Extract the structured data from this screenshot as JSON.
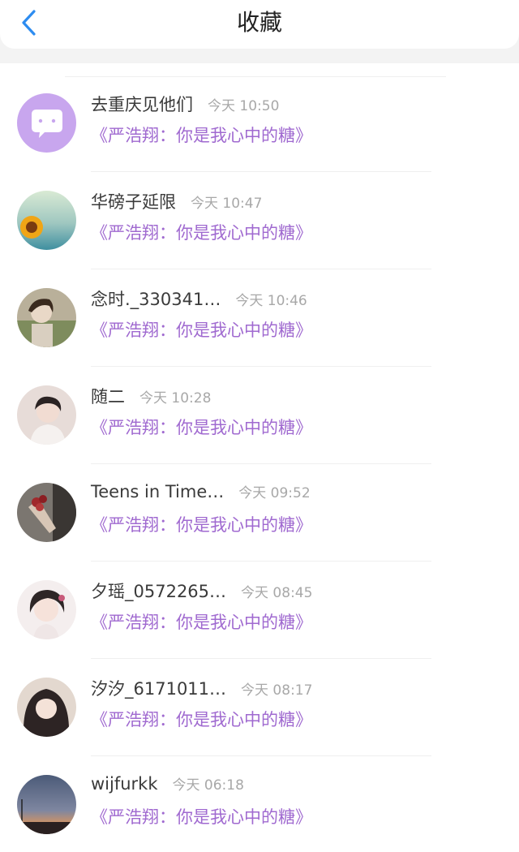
{
  "header": {
    "title": "收藏"
  },
  "colors": {
    "accent_blue": "#2d8cf0",
    "message_purple": "#a06ad0",
    "badge_purple": "#c8a6ee"
  },
  "items": [
    {
      "name": "去重庆见他们",
      "time": "今天 10:50",
      "message": "《严浩翔：你是我心中的糖》",
      "avatar": "chat-bubble"
    },
    {
      "name": "华磅子延限",
      "time": "今天 10:47",
      "message": "《严浩翔：你是我心中的糖》",
      "avatar": "sunflower"
    },
    {
      "name": "念时._330341…",
      "time": "今天 10:46",
      "message": "《严浩翔：你是我心中的糖》",
      "avatar": "person-photo"
    },
    {
      "name": "随二",
      "time": "今天 10:28",
      "message": "《严浩翔：你是我心中的糖》",
      "avatar": "person-photo"
    },
    {
      "name": "Teens in Time…",
      "time": "今天 09:52",
      "message": "《严浩翔：你是我心中的糖》",
      "avatar": "bouquet"
    },
    {
      "name": "夕瑶_0572265…",
      "time": "今天 08:45",
      "message": "《严浩翔：你是我心中的糖》",
      "avatar": "person-photo"
    },
    {
      "name": "汐汐_6171011…",
      "time": "今天 08:17",
      "message": "《严浩翔：你是我心中的糖》",
      "avatar": "person-photo"
    },
    {
      "name": "wijfurkk",
      "time": "今天 06:18",
      "message": "《严浩翔：你是我心中的糖》",
      "avatar": "sunset"
    }
  ]
}
